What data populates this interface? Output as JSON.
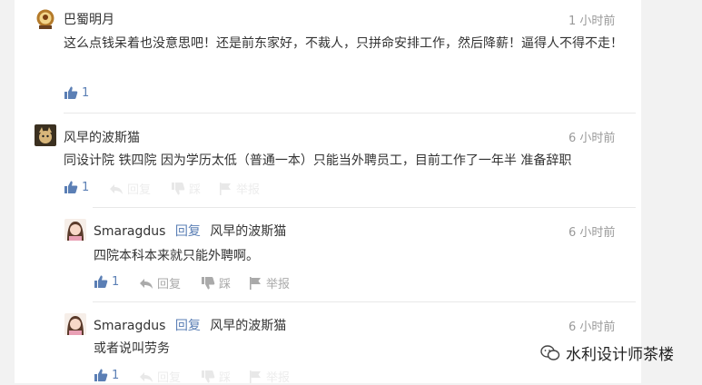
{
  "colors": {
    "link": "#5b7fb5",
    "muted": "#999999",
    "divider": "#e8e8e8"
  },
  "comments": [
    {
      "author": "巴蜀明月",
      "time": "1 小时前",
      "text": "这么点钱呆着也没意思吧！还是前东家好，不裁人，只拼命安排工作，然后降薪！逼得人不得不走！",
      "likes": "1",
      "avatar_icon": "badge-avatar-icon"
    },
    {
      "author": "风早的波斯猫",
      "time": "6 小时前",
      "text": "同设计院 铁四院 因为学历太低（普通一本）只能当外聘员工，目前工作了一年半 准备辞职",
      "likes": "1",
      "actions": {
        "reply": "回复",
        "dislike": "踩",
        "report": "举报"
      },
      "replies": [
        {
          "author": "Smaragdus",
          "reply_word": "回复",
          "reply_to": "风早的波斯猫",
          "time": "6 小时前",
          "text": "四院本科本来就只能外聘啊。",
          "likes": "1",
          "actions": {
            "reply": "回复",
            "dislike": "踩",
            "report": "举报"
          }
        },
        {
          "author": "Smaragdus",
          "reply_word": "回复",
          "reply_to": "风早的波斯猫",
          "time": "6 小时前",
          "text": "或者说叫劳务",
          "likes": "1",
          "actions": {
            "reply": "回复",
            "dislike": "踩",
            "report": "举报"
          }
        }
      ]
    }
  ],
  "watermark": {
    "text": "水利设计师茶楼",
    "icon": "wechat-icon"
  }
}
